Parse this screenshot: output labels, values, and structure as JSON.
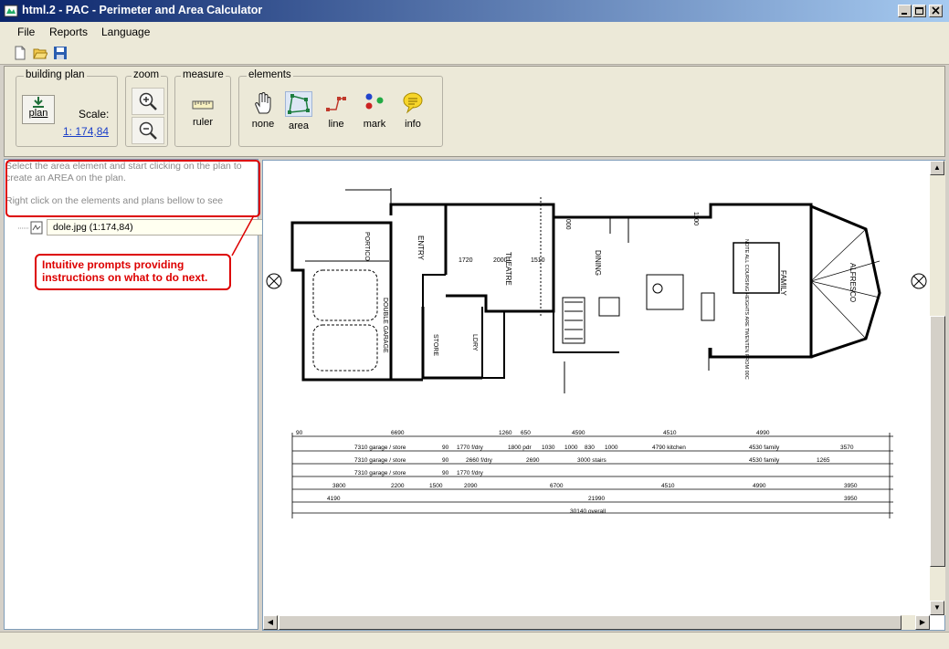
{
  "window": {
    "title": "html.2 - PAC - Perimeter and Area Calculator"
  },
  "menu": [
    "File",
    "Reports",
    "Language"
  ],
  "groups": {
    "building_plan": {
      "label": "building plan",
      "plan_button": "plan",
      "scale_label": "Scale:",
      "scale_value": "1: 174,84"
    },
    "zoom": {
      "label": "zoom"
    },
    "measure": {
      "label": "measure",
      "ruler": "ruler"
    },
    "elements": {
      "label": "elements",
      "none": "none",
      "area": "area",
      "line": "line",
      "mark": "mark",
      "info": "info"
    }
  },
  "hint": {
    "line1": "Select the area element and start clicking on the plan to create an AREA on the plan.",
    "line2": "Right click on the elements and plans bellow to see"
  },
  "tree": {
    "item": "dole.jpg (1:174,84)"
  },
  "callout": "Intuitive prompts providing instructions on what to do next.",
  "plan": {
    "rooms": [
      "THEATRE",
      "DINING",
      "FAMILY",
      "ALFRESCO",
      "ENTRY",
      "PORTICO",
      "DOUBLE GARAGE",
      "STORE",
      "LDRY",
      "NOTE ALL COURSING HEIGHTS ARE TWENTEN FROM 00C"
    ],
    "dims_row1": [
      "90",
      "6690",
      "1260",
      "650",
      "4590",
      "4510",
      "4990"
    ],
    "dims_row2": [
      "7310 garage / store",
      "90",
      "1770 f/dry",
      "1800 pdr",
      "1030",
      "1000",
      "830",
      "1000",
      "4790 kitchen",
      "4530 family",
      "3570"
    ],
    "dims_row3": [
      "7310 garage / store",
      "90",
      "2660 f/dry",
      "2690",
      "3000 stairs",
      "4530 family",
      "1265"
    ],
    "dims_row4": [
      "7310 garage / store",
      "90",
      "1770 f/dry"
    ],
    "dims_row5": [
      "3800",
      "2200",
      "1500",
      "2090",
      "6700",
      "4510",
      "4990",
      "3950"
    ],
    "dims_row6": [
      "4190",
      "21990",
      "3950"
    ],
    "overall": "30140 overall",
    "small_dims": [
      "1720",
      "2000",
      "1510",
      "1000",
      "1100"
    ]
  }
}
